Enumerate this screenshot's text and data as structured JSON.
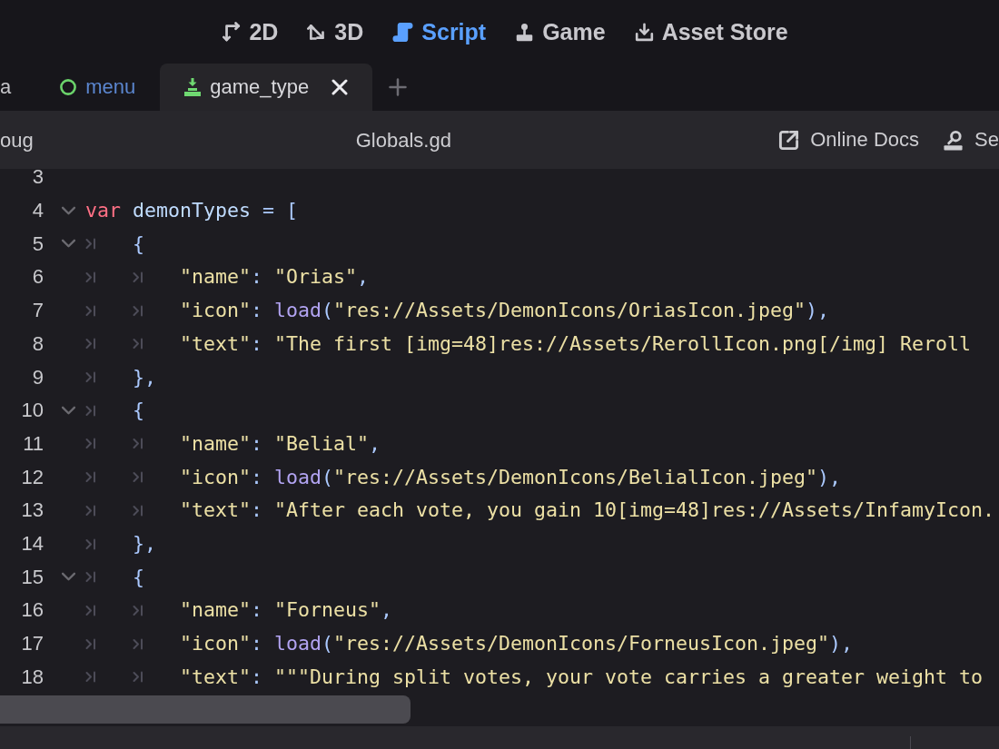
{
  "main_menu": [
    {
      "label": "2D",
      "selected": false
    },
    {
      "label": "3D",
      "selected": false
    },
    {
      "label": "Script",
      "selected": true
    },
    {
      "label": "Game",
      "selected": false
    },
    {
      "label": "Asset Store",
      "selected": false
    }
  ],
  "tabs": [
    {
      "label": "a",
      "selected": false
    },
    {
      "label": "menu",
      "selected": false,
      "color": "#5b86cf"
    },
    {
      "label": "game_type",
      "selected": true
    }
  ],
  "toolbar": {
    "menu": "oug",
    "file_name": "Globals.gd",
    "buttons": [
      "Online Docs",
      "Se"
    ]
  },
  "editor": {
    "lines": [
      {
        "number": "3",
        "foldable": false
      },
      {
        "number": "4",
        "foldable": true,
        "tokens": [
          {
            "kind": "keyword",
            "text": "var"
          },
          {
            "kind": "identifier",
            "text": " demonTypes"
          },
          {
            "kind": "symbol",
            "text": " = ["
          }
        ]
      },
      {
        "number": "5",
        "foldable": true,
        "tokens": [
          {
            "kind": "tab"
          },
          {
            "kind": "symbol",
            "text": "{"
          }
        ]
      },
      {
        "number": "6",
        "foldable": false,
        "tokens": [
          {
            "kind": "tab"
          },
          {
            "kind": "tab"
          },
          {
            "kind": "string",
            "text": "\"name\""
          },
          {
            "kind": "symbol",
            "text": ": "
          },
          {
            "kind": "string",
            "text": "\"Orias\""
          },
          {
            "kind": "symbol",
            "text": ","
          }
        ]
      },
      {
        "number": "7",
        "foldable": false,
        "tokens": [
          {
            "kind": "tab"
          },
          {
            "kind": "tab"
          },
          {
            "kind": "string",
            "text": "\"icon\""
          },
          {
            "kind": "symbol",
            "text": ": "
          },
          {
            "kind": "function",
            "text": "load"
          },
          {
            "kind": "symbol",
            "text": "("
          },
          {
            "kind": "string",
            "text": "\"res://Assets/DemonIcons/OriasIcon.jpeg\""
          },
          {
            "kind": "symbol",
            "text": "),"
          }
        ]
      },
      {
        "number": "8",
        "foldable": false,
        "tokens": [
          {
            "kind": "tab"
          },
          {
            "kind": "tab"
          },
          {
            "kind": "string",
            "text": "\"text\""
          },
          {
            "kind": "symbol",
            "text": ": "
          },
          {
            "kind": "string",
            "text": "\"The first [img=48]res://Assets/RerollIcon.png[/img] Reroll"
          }
        ]
      },
      {
        "number": "9",
        "foldable": false,
        "tokens": [
          {
            "kind": "tab"
          },
          {
            "kind": "symbol",
            "text": "},"
          }
        ]
      },
      {
        "number": "10",
        "foldable": true,
        "tokens": [
          {
            "kind": "tab"
          },
          {
            "kind": "symbol",
            "text": "{"
          }
        ]
      },
      {
        "number": "11",
        "foldable": false,
        "tokens": [
          {
            "kind": "tab"
          },
          {
            "kind": "tab"
          },
          {
            "kind": "string",
            "text": "\"name\""
          },
          {
            "kind": "symbol",
            "text": ": "
          },
          {
            "kind": "string",
            "text": "\"Belial\""
          },
          {
            "kind": "symbol",
            "text": ","
          }
        ]
      },
      {
        "number": "12",
        "foldable": false,
        "tokens": [
          {
            "kind": "tab"
          },
          {
            "kind": "tab"
          },
          {
            "kind": "string",
            "text": "\"icon\""
          },
          {
            "kind": "symbol",
            "text": ": "
          },
          {
            "kind": "function",
            "text": "load"
          },
          {
            "kind": "symbol",
            "text": "("
          },
          {
            "kind": "string",
            "text": "\"res://Assets/DemonIcons/BelialIcon.jpeg\""
          },
          {
            "kind": "symbol",
            "text": "),"
          }
        ]
      },
      {
        "number": "13",
        "foldable": false,
        "tokens": [
          {
            "kind": "tab"
          },
          {
            "kind": "tab"
          },
          {
            "kind": "string",
            "text": "\"text\""
          },
          {
            "kind": "symbol",
            "text": ": "
          },
          {
            "kind": "string",
            "text": "\"After each vote, you gain 10[img=48]res://Assets/InfamyIcon."
          }
        ]
      },
      {
        "number": "14",
        "foldable": false,
        "tokens": [
          {
            "kind": "tab"
          },
          {
            "kind": "symbol",
            "text": "},"
          }
        ]
      },
      {
        "number": "15",
        "foldable": true,
        "tokens": [
          {
            "kind": "tab"
          },
          {
            "kind": "symbol",
            "text": "{"
          }
        ]
      },
      {
        "number": "16",
        "foldable": false,
        "tokens": [
          {
            "kind": "tab"
          },
          {
            "kind": "tab"
          },
          {
            "kind": "string",
            "text": "\"name\""
          },
          {
            "kind": "symbol",
            "text": ": "
          },
          {
            "kind": "string",
            "text": "\"Forneus\""
          },
          {
            "kind": "symbol",
            "text": ","
          }
        ]
      },
      {
        "number": "17",
        "foldable": false,
        "tokens": [
          {
            "kind": "tab"
          },
          {
            "kind": "tab"
          },
          {
            "kind": "string",
            "text": "\"icon\""
          },
          {
            "kind": "symbol",
            "text": ": "
          },
          {
            "kind": "function",
            "text": "load"
          },
          {
            "kind": "symbol",
            "text": "("
          },
          {
            "kind": "string",
            "text": "\"res://Assets/DemonIcons/ForneusIcon.jpeg\""
          },
          {
            "kind": "symbol",
            "text": "),"
          }
        ]
      },
      {
        "number": "18",
        "foldable": false,
        "tokens": [
          {
            "kind": "tab"
          },
          {
            "kind": "tab"
          },
          {
            "kind": "string",
            "text": "\"text\""
          },
          {
            "kind": "symbol",
            "text": ": "
          },
          {
            "kind": "string",
            "text": "\"\"\"During split votes, your vote carries a greater weight to"
          }
        ]
      }
    ]
  }
}
